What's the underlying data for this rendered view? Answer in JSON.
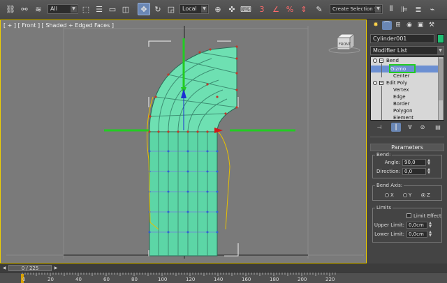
{
  "toolbar": {
    "selection_filter": "All",
    "ref_coord_system": "Local",
    "named_selection": "Create Selection Se",
    "icons": [
      "link-icon",
      "unlink-icon",
      "bind-space-warp-icon",
      "select-object-icon",
      "select-by-name-icon",
      "rect-region-icon",
      "window-crossing-icon",
      "move-icon",
      "rotate-icon",
      "scale-icon",
      "pivot-icon",
      "select-manipulate-icon",
      "keyboard-shortcut-icon",
      "snap-3-icon",
      "angle-snap-icon",
      "percent-snap-icon",
      "spinner-snap-icon",
      "edit-named-selections-icon",
      "mirror-icon",
      "align-icon",
      "layer-manager-icon",
      "graph-editor-icon",
      "schematic-icon",
      "material-editor-icon",
      "render-setup-icon",
      "render-frame-icon",
      "render-icon"
    ]
  },
  "viewport": {
    "label": "[ + ] [ Front ] [ Shaded + Edged Faces ]",
    "viewcube_label": "FRONT"
  },
  "command_panel": {
    "object_name": "Cylinder001",
    "object_color": "#1fbf73",
    "modifier_list": "Modifier List",
    "stack": [
      {
        "label": "Bend",
        "level": 0
      },
      {
        "label": "Gizmo",
        "level": 1,
        "selected": true
      },
      {
        "label": "Center",
        "level": 1
      },
      {
        "label": "Edit Poly",
        "level": 0
      },
      {
        "label": "Vertex",
        "level": 1
      },
      {
        "label": "Edge",
        "level": 1
      },
      {
        "label": "Border",
        "level": 1
      },
      {
        "label": "Polygon",
        "level": 1
      },
      {
        "label": "Element",
        "level": 1
      }
    ],
    "highlight_color": "#22cc22",
    "parameters": {
      "rollout_title": "Parameters",
      "bend_group": "Bend:",
      "angle_label": "Angle:",
      "angle_value": "90,0",
      "direction_label": "Direction:",
      "direction_value": "0,0",
      "axis_group": "Bend Axis:",
      "axis_x": "X",
      "axis_y": "Y",
      "axis_z": "Z",
      "selected_axis": "Z",
      "limits_group": "Limits",
      "limit_effect": "Limit Effect",
      "upper_label": "Upper Limit:",
      "upper_value": "0,0cm",
      "lower_label": "Lower Limit:",
      "lower_value": "0,0cm"
    }
  },
  "timeline": {
    "frame_readout": "0 / 225",
    "ticks": [
      "0",
      "20",
      "40",
      "60",
      "80",
      "100",
      "120",
      "140",
      "160",
      "180",
      "200",
      "220"
    ]
  }
}
